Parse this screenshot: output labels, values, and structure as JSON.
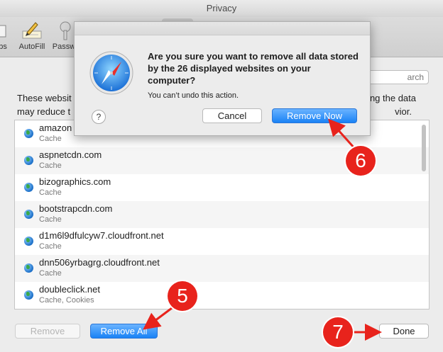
{
  "window": {
    "title": "Privacy"
  },
  "toolbar": {
    "tabs_label": "abs",
    "autofill_label": "AutoFill",
    "passwords_label": "Passw"
  },
  "search": {
    "placeholder": "arch"
  },
  "description": {
    "line1_left": "These websit",
    "line1_right": "ng the data",
    "line2_left": "may reduce t",
    "line2_right": "vior."
  },
  "sites": [
    {
      "name": "amazon",
      "kind": "Cache"
    },
    {
      "name": "aspnetcdn.com",
      "kind": "Cache"
    },
    {
      "name": "bizographics.com",
      "kind": "Cache"
    },
    {
      "name": "bootstrapcdn.com",
      "kind": "Cache"
    },
    {
      "name": "d1m6l9dfulcyw7.cloudfront.net",
      "kind": "Cache"
    },
    {
      "name": "dnn506yrbagrg.cloudfront.net",
      "kind": "Cache"
    },
    {
      "name": "doubleclick.net",
      "kind": "Cache, Cookies"
    }
  ],
  "buttons": {
    "remove": "Remove",
    "remove_all": "Remove All",
    "done": "Done"
  },
  "dialog": {
    "title": "Are you sure you want to remove all data stored by the 26 displayed websites on your computer?",
    "subtitle": "You can’t undo this action.",
    "help": "?",
    "cancel": "Cancel",
    "remove_now": "Remove Now"
  },
  "callouts": {
    "five": "5",
    "six": "6",
    "seven": "7"
  },
  "colors": {
    "accent": "#1a82f5",
    "callout": "#e8231c"
  },
  "icons": {
    "dialog": "safari-compass-icon",
    "site": "globe-icon",
    "help": "help-icon"
  }
}
